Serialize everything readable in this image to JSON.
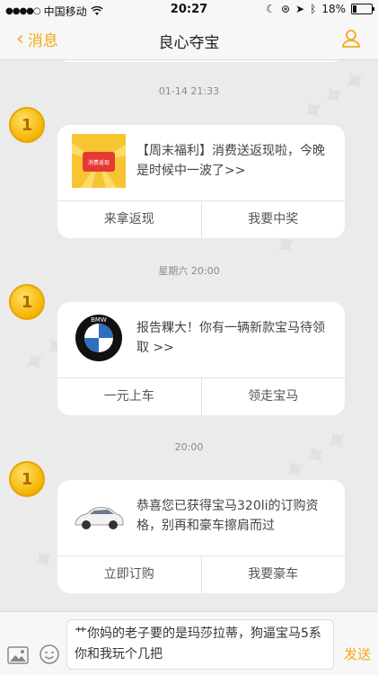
{
  "status_bar": {
    "carrier": "中国移动",
    "time": "20:27",
    "battery": "18%",
    "battery_level": 0.18
  },
  "nav": {
    "back_label": "消息",
    "title": "良心夺宝"
  },
  "messages": [
    {
      "timestamp": "01-14 21:33",
      "avatar_label": "1",
      "text": "【周末福利】消费送返现啦，今晚是时候中一波了>>",
      "thumb_label": "消费返现",
      "buttons": [
        "来拿返现",
        "我要中奖"
      ]
    },
    {
      "timestamp": "星期六 20:00",
      "avatar_label": "1",
      "text": "报告粿大！你有一辆新款宝马待领取 >>",
      "thumb_label": "BMW",
      "buttons": [
        "一元上车",
        "领走宝马"
      ]
    },
    {
      "timestamp": "20:00",
      "avatar_label": "1",
      "text": "恭喜您已获得宝马320li的订购资格，别再和豪车擦肩而过",
      "buttons": [
        "立即订购",
        "我要豪车"
      ]
    }
  ],
  "input": {
    "value": "艹你妈的老子要的是玛莎拉蒂，狗逼宝马5系你和我玩个几把",
    "send_label": "发送"
  },
  "colors": {
    "accent": "#f6a818",
    "coin": "#f4b400",
    "background": "#ebebeb"
  }
}
